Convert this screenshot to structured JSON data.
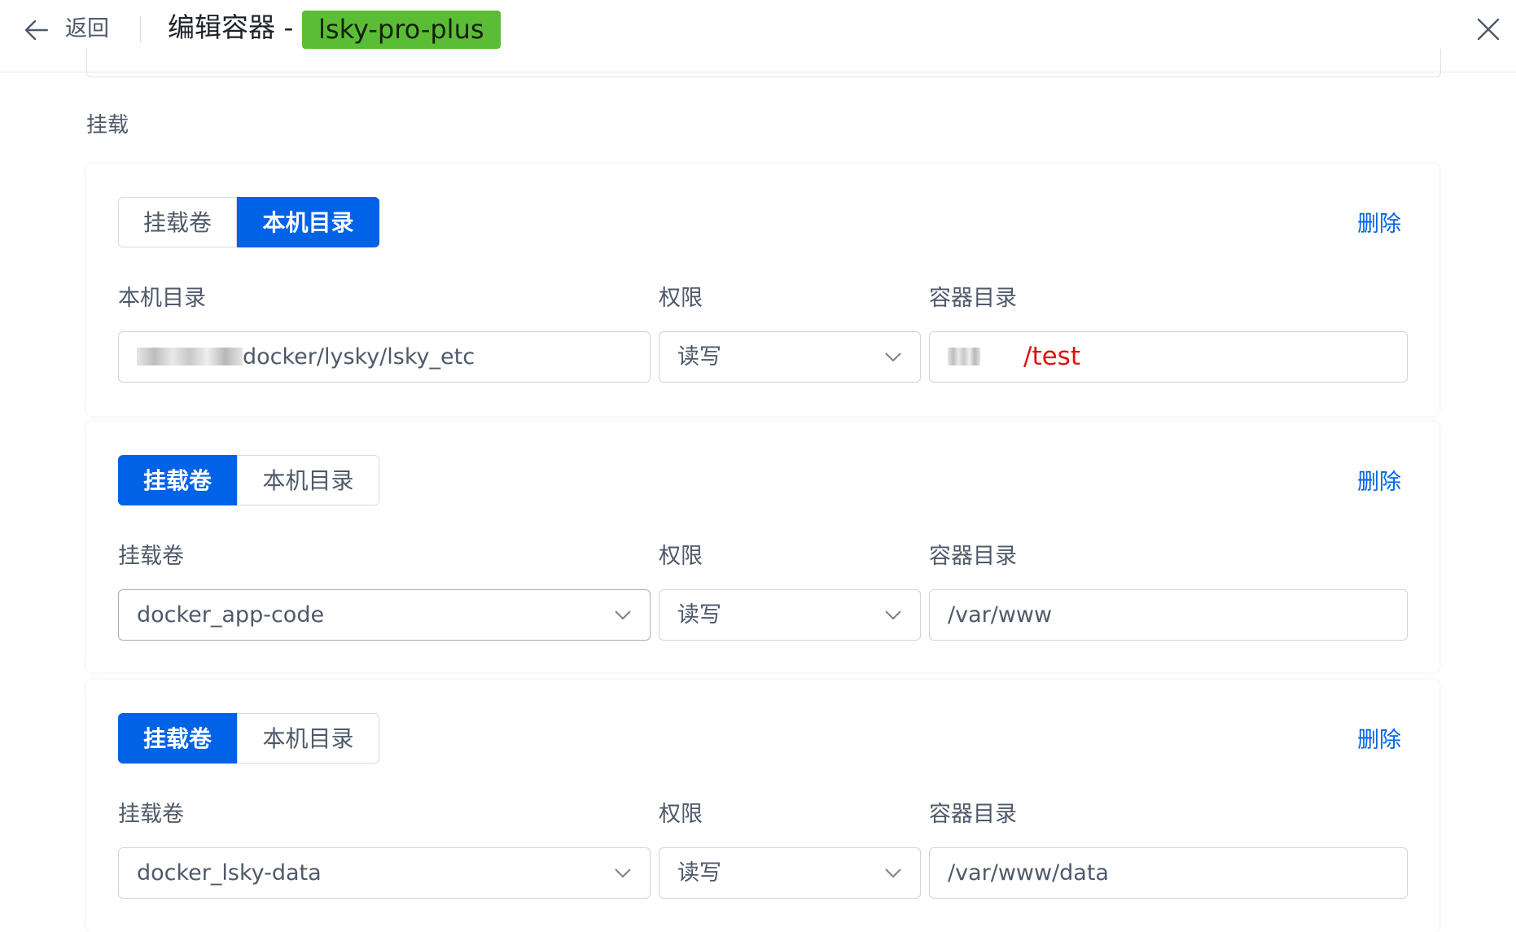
{
  "header": {
    "back_label": "返回",
    "title": "编辑容器 -",
    "container_name": "lsky-pro-plus",
    "name_tag_color": "#5bbd35"
  },
  "section": {
    "label": "挂载"
  },
  "mounts": [
    {
      "seg_volume": "挂载卷",
      "seg_host": "本机目录",
      "selected": "本机目录",
      "delete_label": "删除",
      "source_label": "本机目录",
      "source_value": "docker/lysky/lsky_etc",
      "perm_label": "权限",
      "perm_value": "读写",
      "target_label": "容器目录",
      "target_value": "/test"
    },
    {
      "seg_volume": "挂载卷",
      "seg_host": "本机目录",
      "selected": "挂载卷",
      "delete_label": "删除",
      "source_label": "挂载卷",
      "source_value": "docker_app-code",
      "perm_label": "权限",
      "perm_value": "读写",
      "target_label": "容器目录",
      "target_value": "/var/www"
    },
    {
      "seg_volume": "挂载卷",
      "seg_host": "本机目录",
      "selected": "挂载卷",
      "delete_label": "删除",
      "source_label": "挂载卷",
      "source_value": "docker_lsky-data",
      "perm_label": "权限",
      "perm_value": "读写",
      "target_label": "容器目录",
      "target_value": "/var/www/data"
    }
  ],
  "colors": {
    "accent": "#0062e6",
    "annotation": "#e01313"
  }
}
